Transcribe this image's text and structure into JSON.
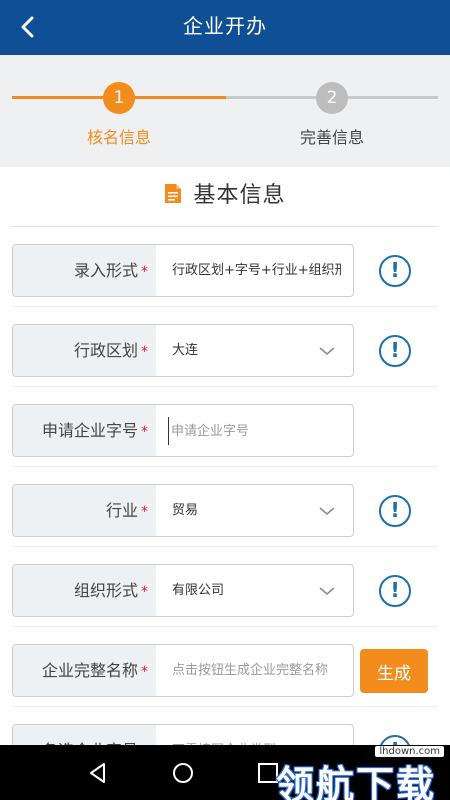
{
  "header": {
    "title": "企业开办"
  },
  "steps": [
    {
      "number": "1",
      "label": "核名信息",
      "active": true
    },
    {
      "number": "2",
      "label": "完善信息",
      "active": false
    }
  ],
  "section": {
    "title": "基本信息"
  },
  "form": {
    "required_mark": "*",
    "entry_form": {
      "label": "录入形式",
      "value": "行政区划+字号+行业+组织形式"
    },
    "region": {
      "label": "行政区划",
      "value": "大连"
    },
    "trade_name": {
      "label": "申请企业字号",
      "placeholder": "申请企业字号"
    },
    "industry": {
      "label": "行业",
      "value": "贸易"
    },
    "org_form": {
      "label": "组织形式",
      "value": "有限公司"
    },
    "full_name": {
      "label": "企业完整名称",
      "placeholder": "点击按钮生成企业完整名称",
      "button": "生成"
    },
    "alt_name": {
      "label": "备选企业字号",
      "placeholder": "不需填写企业类型"
    }
  },
  "info_icon": "!",
  "watermark": {
    "site": "lhdown.com",
    "brand": "领航下载"
  },
  "colors": {
    "header": "#0e4f96",
    "accent": "#f28c1c",
    "info": "#1d6fa8"
  }
}
